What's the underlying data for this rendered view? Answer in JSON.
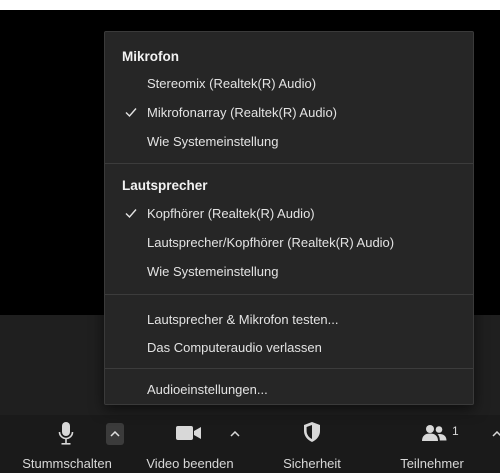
{
  "audio_menu": {
    "microphone": {
      "header": "Mikrofon",
      "items": [
        {
          "label": "Stereomix (Realtek(R) Audio)",
          "checked": false
        },
        {
          "label": "Mikrofonarray (Realtek(R) Audio)",
          "checked": true
        },
        {
          "label": "Wie Systemeinstellung",
          "checked": false
        }
      ]
    },
    "speaker": {
      "header": "Lautsprecher",
      "items": [
        {
          "label": "Kopfhörer (Realtek(R) Audio)",
          "checked": true
        },
        {
          "label": "Lautsprecher/Kopfhörer (Realtek(R) Audio)",
          "checked": false
        },
        {
          "label": "Wie Systemeinstellung",
          "checked": false
        }
      ]
    },
    "actions": [
      {
        "label": "Lautsprecher & Mikrofon testen..."
      },
      {
        "label": "Das Computeraudio verlassen"
      }
    ],
    "settings": {
      "label": "Audioeinstellungen..."
    }
  },
  "toolbar": {
    "mute": {
      "label": "Stummschalten",
      "icon": "microphone-icon"
    },
    "video": {
      "label": "Video beenden",
      "icon": "video-camera-icon"
    },
    "security": {
      "label": "Sicherheit",
      "icon": "shield-icon"
    },
    "participants": {
      "label": "Teilnehmer",
      "count": "1",
      "icon": "participants-icon"
    }
  },
  "colors": {
    "menu_bg": "#262626",
    "toolbar_bg": "#1a1a1a",
    "text": "#e3e3e3"
  }
}
